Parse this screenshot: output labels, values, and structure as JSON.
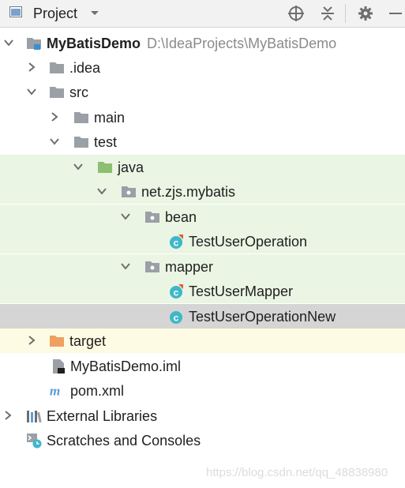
{
  "toolbar": {
    "title": "Project",
    "buttons": [
      "locate-icon",
      "collapse-all-icon",
      "gear-icon",
      "minimize-icon"
    ]
  },
  "tree": {
    "root": {
      "label": "MyBatisDemo",
      "path": "D:\\IdeaProjects\\MyBatisDemo"
    },
    "idea": "idea",
    "idea_prefix": ".",
    "src": "src",
    "main": "main",
    "test": "test",
    "java": "java",
    "package": "net.zjs.mybatis",
    "bean": "bean",
    "test_user_operation": "TestUserOperation",
    "mapper": "mapper",
    "test_user_mapper": "TestUserMapper",
    "test_user_operation_new": "TestUserOperationNew",
    "target": "target",
    "iml": "MyBatisDemo.iml",
    "pom": "pom.xml",
    "external_libraries": "External Libraries",
    "scratches": "Scratches and Consoles"
  },
  "colors": {
    "test_sources_bg": "#eaf5e4",
    "selected_bg": "#d5d5d5",
    "excluded_bg": "#fdfbe3",
    "folder_gray": "#9aa0a6",
    "folder_green": "#8cc070",
    "folder_orange": "#f0a060",
    "class_teal": "#3fb7c8"
  },
  "watermark": "https://blog.csdn.net/qq_48838980"
}
